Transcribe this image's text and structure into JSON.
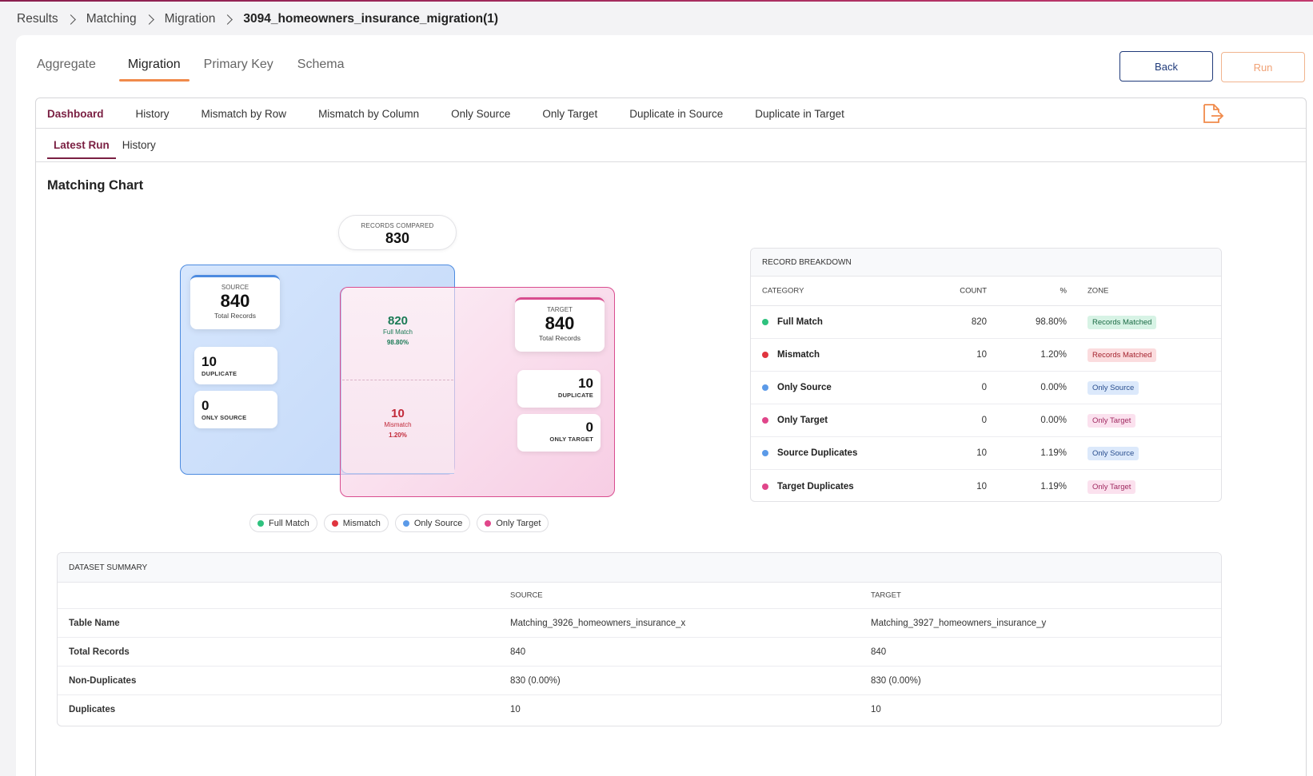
{
  "breadcrumb": {
    "items": [
      "Results",
      "Matching",
      "Migration"
    ],
    "current": "3094_homeowners_insurance_migration(1)"
  },
  "tabs": [
    {
      "label": "Aggregate",
      "active": false
    },
    {
      "label": "Migration",
      "active": true
    },
    {
      "label": "Primary Key",
      "active": false
    },
    {
      "label": "Schema",
      "active": false
    }
  ],
  "buttons": {
    "back": "Back",
    "run": "Run"
  },
  "subtabs": [
    "Dashboard",
    "History",
    "Mismatch by Row",
    "Mismatch by Column",
    "Only Source",
    "Only Target",
    "Duplicate in Source",
    "Duplicate in Target"
  ],
  "runtabs": [
    "Latest Run",
    "History"
  ],
  "chart_title": "Matching Chart",
  "venn": {
    "records_compared_label": "RECORDS COMPARED",
    "records_compared": "830",
    "source": {
      "label": "SOURCE",
      "total": "840",
      "sub": "Total Records",
      "duplicate": "10",
      "duplicate_label": "DUPLICATE",
      "only": "0",
      "only_label": "ONLY SOURCE"
    },
    "target": {
      "label": "TARGET",
      "total": "840",
      "sub": "Total Records",
      "duplicate": "10",
      "duplicate_label": "DUPLICATE",
      "only": "0",
      "only_label": "ONLY TARGET"
    },
    "full_match": {
      "value": "820",
      "label": "Full Match",
      "pct": "98.80%"
    },
    "mismatch": {
      "value": "10",
      "label": "Mismatch",
      "pct": "1.20%"
    }
  },
  "legend": [
    {
      "label": "Full Match",
      "color": "#2ec27e"
    },
    {
      "label": "Mismatch",
      "color": "#e0353f"
    },
    {
      "label": "Only Source",
      "color": "#5b9ae8"
    },
    {
      "label": "Only Target",
      "color": "#e0468a"
    }
  ],
  "breakdown": {
    "title": "RECORD BREAKDOWN",
    "columns": {
      "category": "CATEGORY",
      "count": "COUNT",
      "pct": "%",
      "zone": "ZONE"
    },
    "rows": [
      {
        "category": "Full Match",
        "count": "820",
        "pct": "98.80%",
        "zone": "Records Matched",
        "dot": "#2ec27e"
      },
      {
        "category": "Mismatch",
        "count": "10",
        "pct": "1.20%",
        "zone": "Records Matched",
        "dot": "#e0353f"
      },
      {
        "category": "Only Source",
        "count": "0",
        "pct": "0.00%",
        "zone": "Only Source",
        "dot": "#5b9ae8"
      },
      {
        "category": "Only Target",
        "count": "0",
        "pct": "0.00%",
        "zone": "Only Target",
        "dot": "#e0468a"
      },
      {
        "category": "Source Duplicates",
        "count": "10",
        "pct": "1.19%",
        "zone": "Only Source",
        "dot": "#5b9ae8"
      },
      {
        "category": "Target Duplicates",
        "count": "10",
        "pct": "1.19%",
        "zone": "Only Target",
        "dot": "#e0468a"
      }
    ]
  },
  "summary": {
    "title": "DATASET SUMMARY",
    "columns": {
      "source": "SOURCE",
      "target": "TARGET"
    },
    "rows": [
      {
        "label": "Table Name",
        "source": "Matching_3926_homeowners_insurance_x",
        "target": "Matching_3927_homeowners_insurance_y"
      },
      {
        "label": "Total Records",
        "source": "840",
        "target": "840"
      },
      {
        "label": "Non-Duplicates",
        "source": "830 (0.00%)",
        "target": "830 (0.00%)"
      },
      {
        "label": "Duplicates",
        "source": "10",
        "target": "10"
      }
    ]
  }
}
